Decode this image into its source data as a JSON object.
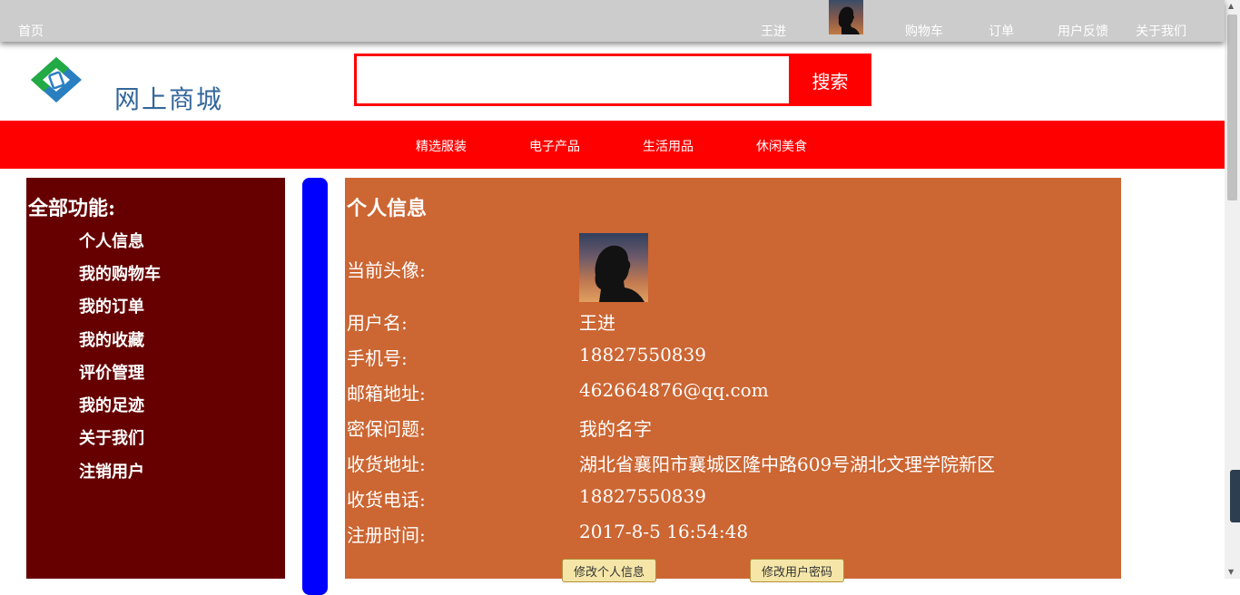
{
  "topnav": {
    "home": "首页",
    "username": "王进",
    "cart": "购物车",
    "orders": "订单",
    "feedback": "用户反馈",
    "about": "关于我们"
  },
  "header": {
    "logo_text": "网上商城",
    "search_value": "",
    "search_button": "搜索"
  },
  "categories": [
    "精选服装",
    "电子产品",
    "生活用品",
    "休闲美食"
  ],
  "sidebar": {
    "title": "全部功能:",
    "items": [
      "个人信息",
      "我的购物车",
      "我的订单",
      "我的收藏",
      "评价管理",
      "我的足迹",
      "关于我们",
      "注销用户"
    ]
  },
  "profile": {
    "title": "个人信息",
    "avatar_label": "当前头像:",
    "fields": [
      {
        "label": "用户名:",
        "value": "王进"
      },
      {
        "label": "手机号:",
        "value": "18827550839"
      },
      {
        "label": "邮箱地址:",
        "value": "462664876@qq.com"
      },
      {
        "label": "密保问题:",
        "value": "我的名字"
      },
      {
        "label": "收货地址:",
        "value": "湖北省襄阳市襄城区隆中路609号湖北文理学院新区"
      },
      {
        "label": "收货电话:",
        "value": "18827550839"
      },
      {
        "label": "注册时间:",
        "value": "2017-8-5 16:54:48"
      }
    ],
    "edit_info_button": "修改个人信息",
    "edit_password_button": "修改用户密码"
  },
  "colors": {
    "topbar": "#cccccc",
    "accent_red": "#ff0000",
    "sidebar_bg": "#660000",
    "divider_blue": "#0000ff",
    "panel_bg": "#cc6633",
    "logo_text": "#336699"
  },
  "icons": {
    "logo": "shop-logo-icon",
    "user_avatar": "avatar-silhouette"
  }
}
